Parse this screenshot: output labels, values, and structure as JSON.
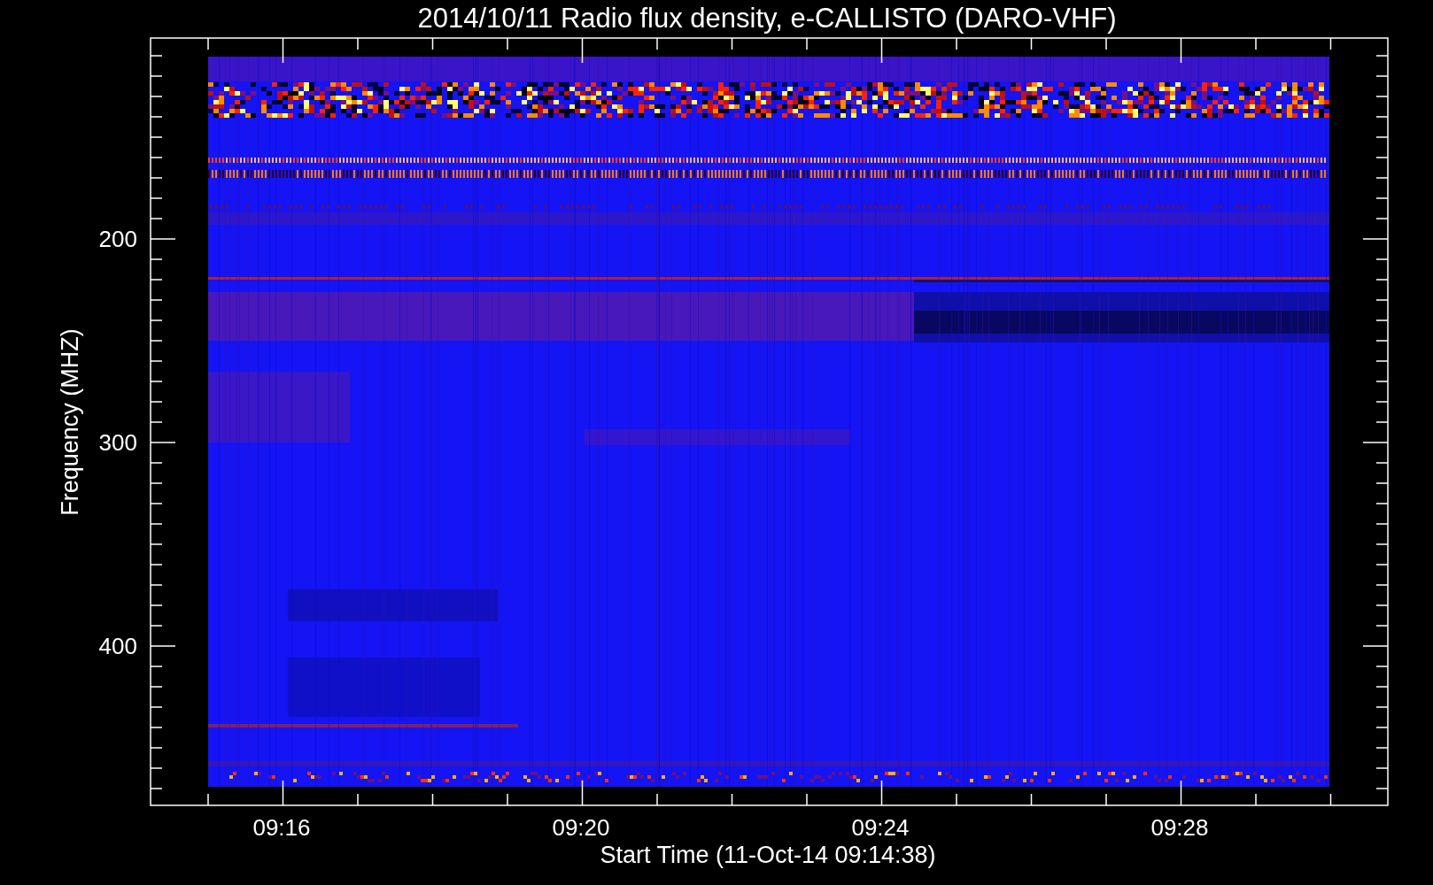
{
  "title": "2014/10/11  Radio flux density, e-CALLISTO (DARO-VHF)",
  "x_axis": {
    "label": "Start Time (11-Oct-14 09:14:38)",
    "ticks": [
      "09:16",
      "09:20",
      "09:24",
      "09:28"
    ]
  },
  "y_axis": {
    "label": "Frequency (MHZ)",
    "ticks": [
      "200",
      "300",
      "400"
    ]
  }
}
